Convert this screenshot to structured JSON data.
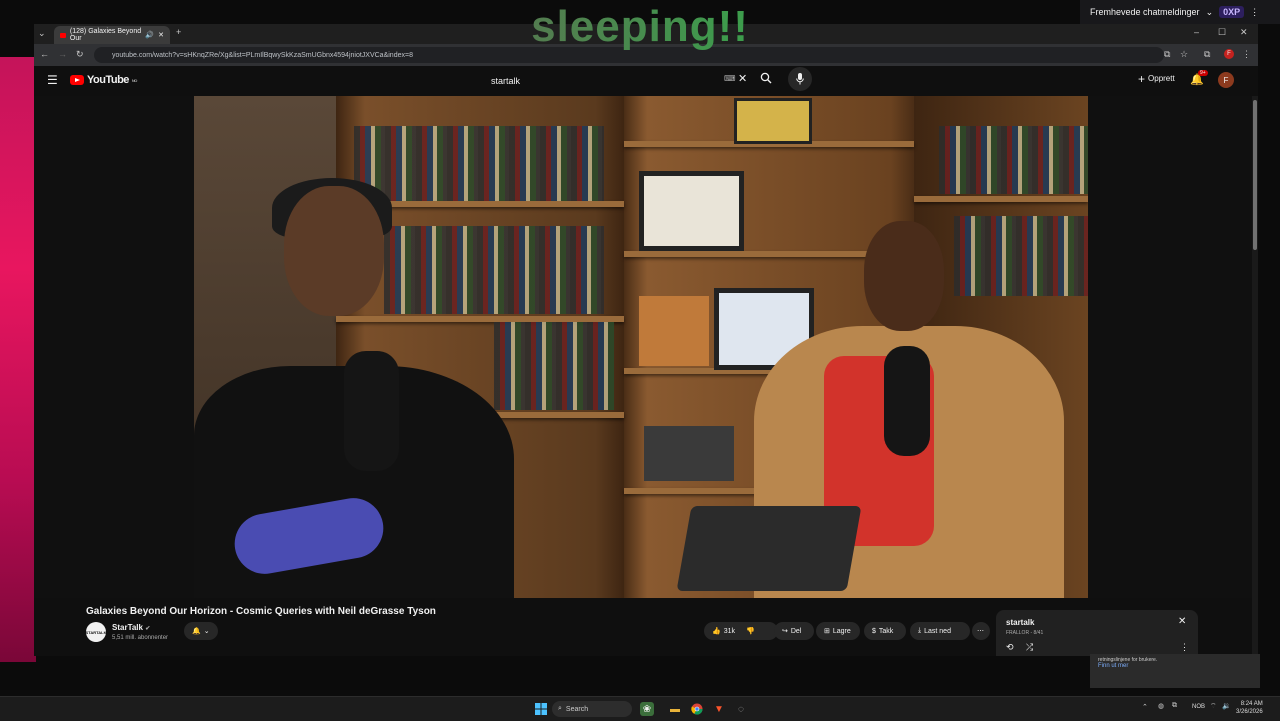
{
  "overlay": {
    "title": "sleeping!!"
  },
  "chat": {
    "label": "Fremhevede chatmeldinger",
    "xp": "0XP"
  },
  "browser": {
    "tab_title": "(128) Galaxies Beyond Our",
    "url": "youtube.com/watch?v=sHKnqZRe/Xg&list=PLmIlBqwySkKzaSmUGbnx4594jniotJXVCa&index=8"
  },
  "youtube": {
    "logo": "YouTube",
    "logo_region": "NO",
    "search_value": "startalk",
    "create_label": "Opprett",
    "notif_count": "9+",
    "avatar_letter": "F"
  },
  "video": {
    "title": "Galaxies Beyond Our Horizon - Cosmic Queries with Neil deGrasse Tyson",
    "channel": "StarTalk",
    "subscribers": "5,51 mill. abonnenter",
    "channel_avatar_text": "STARTALK",
    "likes": "31k",
    "share_label": "Del",
    "save_label": "Lagre",
    "thanks_label": "Takk",
    "download_label": "Last ned"
  },
  "playlist": {
    "title": "startalk",
    "meta": "FRALLOR - 8/41"
  },
  "notification": {
    "text": "retningslinjene for brukere.",
    "link": "Finn ut mer"
  },
  "taskbar": {
    "search_label": "Search",
    "lang": "NOB",
    "time": "8:24 AM",
    "date": "3/26/2026"
  },
  "colors": {
    "youtube_red": "#ff0000",
    "stream_pink": "#e8165f",
    "link_blue": "#7cacf8"
  }
}
